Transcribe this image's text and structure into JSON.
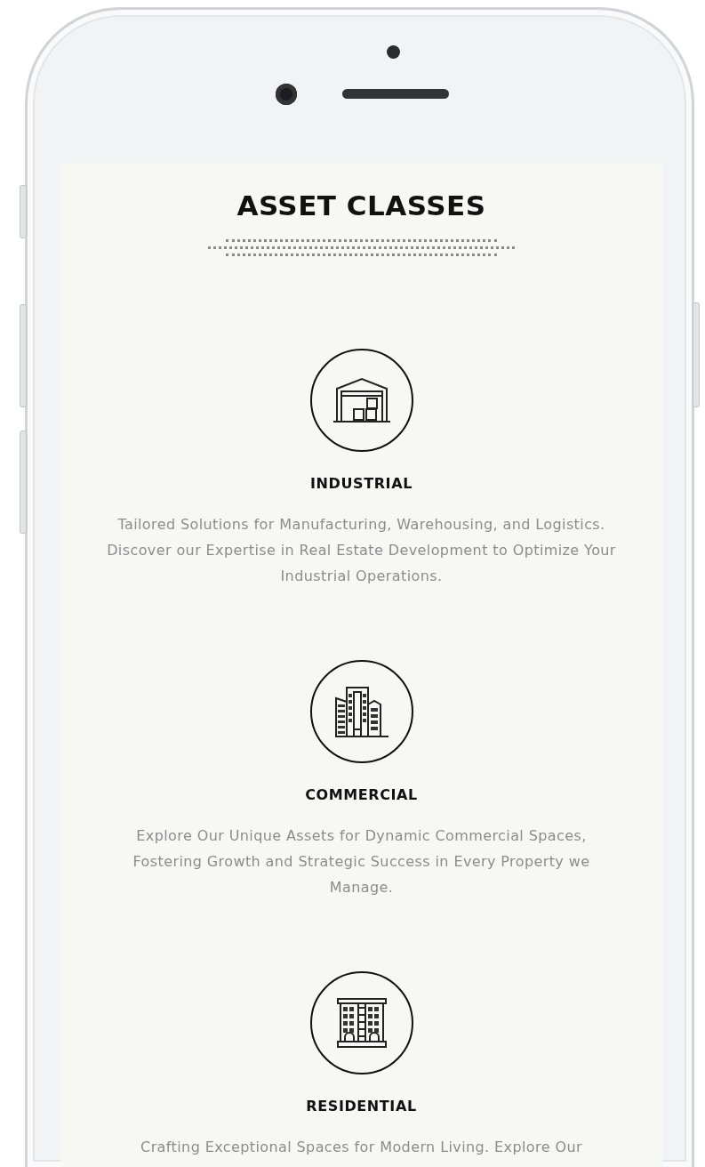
{
  "page": {
    "title": "ASSET CLASSES"
  },
  "asset_classes": [
    {
      "kind": "warehouse",
      "heading": "INDUSTRIAL",
      "description": "Tailored Solutions for Manufacturing, Warehousing, and Logistics. Discover our Expertise in Real Estate Development to Optimize Your Industrial Operations."
    },
    {
      "kind": "offices",
      "heading": "COMMERCIAL",
      "description": "Explore Our Unique Assets for Dynamic Commercial Spaces, Fostering Growth and Strategic Success in Every Property we Manage."
    },
    {
      "kind": "apartments",
      "heading": "RESIDENTIAL",
      "description": "Crafting Exceptional Spaces for Modern Living. Explore Our"
    }
  ]
}
